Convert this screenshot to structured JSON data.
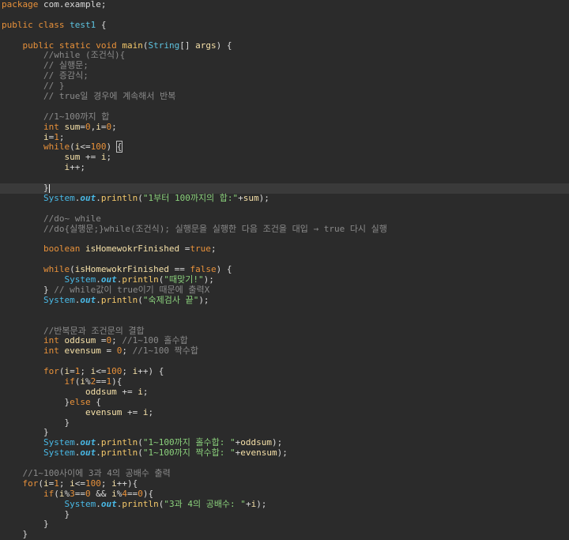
{
  "editor": {
    "current_line_index": 17,
    "cursor_line_index": 17,
    "bracket_match_line_index": 13,
    "lines": [
      [
        [
          "kw",
          "package"
        ],
        [
          "plain",
          " com.example;"
        ]
      ],
      [],
      [
        [
          "kw",
          "public"
        ],
        [
          "plain",
          " "
        ],
        [
          "kw",
          "class"
        ],
        [
          "plain",
          " "
        ],
        [
          "ty",
          "test1"
        ],
        [
          "plain",
          " {"
        ]
      ],
      [],
      [
        [
          "plain",
          "    "
        ],
        [
          "kw",
          "public"
        ],
        [
          "plain",
          " "
        ],
        [
          "kw",
          "static"
        ],
        [
          "plain",
          " "
        ],
        [
          "kw",
          "void"
        ],
        [
          "plain",
          " "
        ],
        [
          "fn",
          "main"
        ],
        [
          "pu",
          "("
        ],
        [
          "ty",
          "String"
        ],
        [
          "pu",
          "[] "
        ],
        [
          "var",
          "args"
        ],
        [
          "pu",
          ") {"
        ]
      ],
      [
        [
          "plain",
          "        "
        ],
        [
          "cm",
          "//while (조건식){"
        ]
      ],
      [
        [
          "plain",
          "        "
        ],
        [
          "cm",
          "// 실행문;"
        ]
      ],
      [
        [
          "plain",
          "        "
        ],
        [
          "cm",
          "// 증감식;"
        ]
      ],
      [
        [
          "plain",
          "        "
        ],
        [
          "cm",
          "// }"
        ]
      ],
      [
        [
          "plain",
          "        "
        ],
        [
          "cm",
          "// true일 경우에 계속해서 반복"
        ]
      ],
      [],
      [
        [
          "plain",
          "        "
        ],
        [
          "cm",
          "//1~100까지 합"
        ]
      ],
      [
        [
          "plain",
          "        "
        ],
        [
          "kw",
          "int"
        ],
        [
          "plain",
          " "
        ],
        [
          "var",
          "sum"
        ],
        [
          "pu",
          "="
        ],
        [
          "num",
          "0"
        ],
        [
          "pu",
          ","
        ],
        [
          "var",
          "i"
        ],
        [
          "pu",
          "="
        ],
        [
          "num",
          "0"
        ],
        [
          "pu",
          ";"
        ]
      ],
      [
        [
          "plain",
          "        "
        ],
        [
          "var",
          "i"
        ],
        [
          "pu",
          "="
        ],
        [
          "num",
          "1"
        ],
        [
          "pu",
          ";"
        ]
      ],
      [
        [
          "plain",
          "        "
        ],
        [
          "kw",
          "while"
        ],
        [
          "pu",
          "("
        ],
        [
          "var",
          "i"
        ],
        [
          "pu",
          "<="
        ],
        [
          "num",
          "100"
        ],
        [
          "pu",
          ") "
        ],
        [
          "bracket",
          "{"
        ]
      ],
      [
        [
          "plain",
          "            "
        ],
        [
          "var",
          "sum"
        ],
        [
          "pu",
          " += "
        ],
        [
          "var",
          "i"
        ],
        [
          "pu",
          ";"
        ]
      ],
      [
        [
          "plain",
          "            "
        ],
        [
          "var",
          "i"
        ],
        [
          "pu",
          "++;"
        ]
      ],
      [],
      [
        [
          "plain",
          "        "
        ],
        [
          "pu",
          "}"
        ],
        [
          "caret",
          ""
        ]
      ],
      [
        [
          "plain",
          "        "
        ],
        [
          "ty2",
          "System"
        ],
        [
          "pu",
          "."
        ],
        [
          "st",
          "out"
        ],
        [
          "pu",
          "."
        ],
        [
          "fn",
          "println"
        ],
        [
          "pu",
          "("
        ],
        [
          "str",
          "\"1부터 100까지의 합:\""
        ],
        [
          "pu",
          "+"
        ],
        [
          "var",
          "sum"
        ],
        [
          "pu",
          ");"
        ]
      ],
      [],
      [
        [
          "plain",
          "        "
        ],
        [
          "cm",
          "//do~ while"
        ]
      ],
      [
        [
          "plain",
          "        "
        ],
        [
          "cm",
          "//do{실행문;}while(조건식); 실행문을 실행한 다음 조건을 대입 → true 다시 실행"
        ]
      ],
      [],
      [
        [
          "plain",
          "        "
        ],
        [
          "kw",
          "boolean"
        ],
        [
          "plain",
          " "
        ],
        [
          "var",
          "isHomewokrFinished"
        ],
        [
          "pu",
          " ="
        ],
        [
          "kw",
          "true"
        ],
        [
          "pu",
          ";"
        ]
      ],
      [],
      [
        [
          "plain",
          "        "
        ],
        [
          "kw",
          "while"
        ],
        [
          "pu",
          "("
        ],
        [
          "var",
          "isHomewokrFinished"
        ],
        [
          "pu",
          " == "
        ],
        [
          "kw",
          "false"
        ],
        [
          "pu",
          ") {"
        ]
      ],
      [
        [
          "plain",
          "            "
        ],
        [
          "ty2",
          "System"
        ],
        [
          "pu",
          "."
        ],
        [
          "st",
          "out"
        ],
        [
          "pu",
          "."
        ],
        [
          "fn",
          "println"
        ],
        [
          "pu",
          "("
        ],
        [
          "str",
          "\"때맞기!\""
        ],
        [
          "pu",
          ");"
        ]
      ],
      [
        [
          "plain",
          "        "
        ],
        [
          "pu",
          "} "
        ],
        [
          "cm",
          "// while값이 true이기 때문에 출력X"
        ]
      ],
      [
        [
          "plain",
          "        "
        ],
        [
          "ty2",
          "System"
        ],
        [
          "pu",
          "."
        ],
        [
          "st",
          "out"
        ],
        [
          "pu",
          "."
        ],
        [
          "fn",
          "println"
        ],
        [
          "pu",
          "("
        ],
        [
          "str",
          "\"숙제검사 끝\""
        ],
        [
          "pu",
          ");"
        ]
      ],
      [],
      [],
      [
        [
          "plain",
          "        "
        ],
        [
          "cm",
          "//반복문과 조건문의 결합"
        ]
      ],
      [
        [
          "plain",
          "        "
        ],
        [
          "kw",
          "int"
        ],
        [
          "plain",
          " "
        ],
        [
          "var",
          "oddsum"
        ],
        [
          "pu",
          " ="
        ],
        [
          "num",
          "0"
        ],
        [
          "pu",
          "; "
        ],
        [
          "cm",
          "//1~100 홀수합"
        ]
      ],
      [
        [
          "plain",
          "        "
        ],
        [
          "kw",
          "int"
        ],
        [
          "plain",
          " "
        ],
        [
          "var",
          "evensum"
        ],
        [
          "pu",
          " = "
        ],
        [
          "num",
          "0"
        ],
        [
          "pu",
          "; "
        ],
        [
          "cm",
          "//1~100 짝수합"
        ]
      ],
      [],
      [
        [
          "plain",
          "        "
        ],
        [
          "kw",
          "for"
        ],
        [
          "pu",
          "("
        ],
        [
          "var",
          "i"
        ],
        [
          "pu",
          "="
        ],
        [
          "num",
          "1"
        ],
        [
          "pu",
          "; "
        ],
        [
          "var",
          "i"
        ],
        [
          "pu",
          "<="
        ],
        [
          "num",
          "100"
        ],
        [
          "pu",
          "; "
        ],
        [
          "var",
          "i"
        ],
        [
          "pu",
          "++) {"
        ]
      ],
      [
        [
          "plain",
          "            "
        ],
        [
          "kw",
          "if"
        ],
        [
          "pu",
          "("
        ],
        [
          "var",
          "i"
        ],
        [
          "pu",
          "%"
        ],
        [
          "num",
          "2"
        ],
        [
          "pu",
          "=="
        ],
        [
          "num",
          "1"
        ],
        [
          "pu",
          "){"
        ]
      ],
      [
        [
          "plain",
          "                "
        ],
        [
          "var",
          "oddsum"
        ],
        [
          "pu",
          " += "
        ],
        [
          "var",
          "i"
        ],
        [
          "pu",
          ";"
        ]
      ],
      [
        [
          "plain",
          "            "
        ],
        [
          "pu",
          "}"
        ],
        [
          "kw",
          "else"
        ],
        [
          "pu",
          " {"
        ]
      ],
      [
        [
          "plain",
          "                "
        ],
        [
          "var",
          "evensum"
        ],
        [
          "pu",
          " += "
        ],
        [
          "var",
          "i"
        ],
        [
          "pu",
          ";"
        ]
      ],
      [
        [
          "plain",
          "            "
        ],
        [
          "pu",
          "}"
        ]
      ],
      [
        [
          "plain",
          "        "
        ],
        [
          "pu",
          "}"
        ]
      ],
      [
        [
          "plain",
          "        "
        ],
        [
          "ty2",
          "System"
        ],
        [
          "pu",
          "."
        ],
        [
          "st",
          "out"
        ],
        [
          "pu",
          "."
        ],
        [
          "fn",
          "println"
        ],
        [
          "pu",
          "("
        ],
        [
          "str",
          "\"1~100까지 홀수합: \""
        ],
        [
          "pu",
          "+"
        ],
        [
          "var",
          "oddsum"
        ],
        [
          "pu",
          ");"
        ]
      ],
      [
        [
          "plain",
          "        "
        ],
        [
          "ty2",
          "System"
        ],
        [
          "pu",
          "."
        ],
        [
          "st",
          "out"
        ],
        [
          "pu",
          "."
        ],
        [
          "fn",
          "println"
        ],
        [
          "pu",
          "("
        ],
        [
          "str",
          "\"1~100까지 짝수합: \""
        ],
        [
          "pu",
          "+"
        ],
        [
          "var",
          "evensum"
        ],
        [
          "pu",
          ");"
        ]
      ],
      [],
      [
        [
          "plain",
          "    "
        ],
        [
          "cm",
          "//1~100사이에 3과 4의 공배수 출력"
        ]
      ],
      [
        [
          "plain",
          "    "
        ],
        [
          "kw",
          "for"
        ],
        [
          "pu",
          "("
        ],
        [
          "var",
          "i"
        ],
        [
          "pu",
          "="
        ],
        [
          "num",
          "1"
        ],
        [
          "pu",
          "; "
        ],
        [
          "var",
          "i"
        ],
        [
          "pu",
          "<="
        ],
        [
          "num",
          "100"
        ],
        [
          "pu",
          "; "
        ],
        [
          "var",
          "i"
        ],
        [
          "pu",
          "++){"
        ]
      ],
      [
        [
          "plain",
          "        "
        ],
        [
          "kw",
          "if"
        ],
        [
          "pu",
          "("
        ],
        [
          "var",
          "i"
        ],
        [
          "pu",
          "%"
        ],
        [
          "num",
          "3"
        ],
        [
          "pu",
          "=="
        ],
        [
          "num",
          "0"
        ],
        [
          "pu",
          " && "
        ],
        [
          "var",
          "i"
        ],
        [
          "pu",
          "%"
        ],
        [
          "num",
          "4"
        ],
        [
          "pu",
          "=="
        ],
        [
          "num",
          "0"
        ],
        [
          "pu",
          "){"
        ]
      ],
      [
        [
          "plain",
          "            "
        ],
        [
          "ty2",
          "System"
        ],
        [
          "pu",
          "."
        ],
        [
          "st",
          "out"
        ],
        [
          "pu",
          "."
        ],
        [
          "fn",
          "println"
        ],
        [
          "pu",
          "("
        ],
        [
          "str",
          "\"3과 4의 공배수: \""
        ],
        [
          "pu",
          "+"
        ],
        [
          "var",
          "i"
        ],
        [
          "pu",
          ");"
        ]
      ],
      [
        [
          "plain",
          "            "
        ],
        [
          "pu",
          "}"
        ]
      ],
      [
        [
          "plain",
          "        "
        ],
        [
          "pu",
          "}"
        ]
      ],
      [
        [
          "plain",
          "    "
        ],
        [
          "pu",
          "}"
        ]
      ]
    ]
  }
}
